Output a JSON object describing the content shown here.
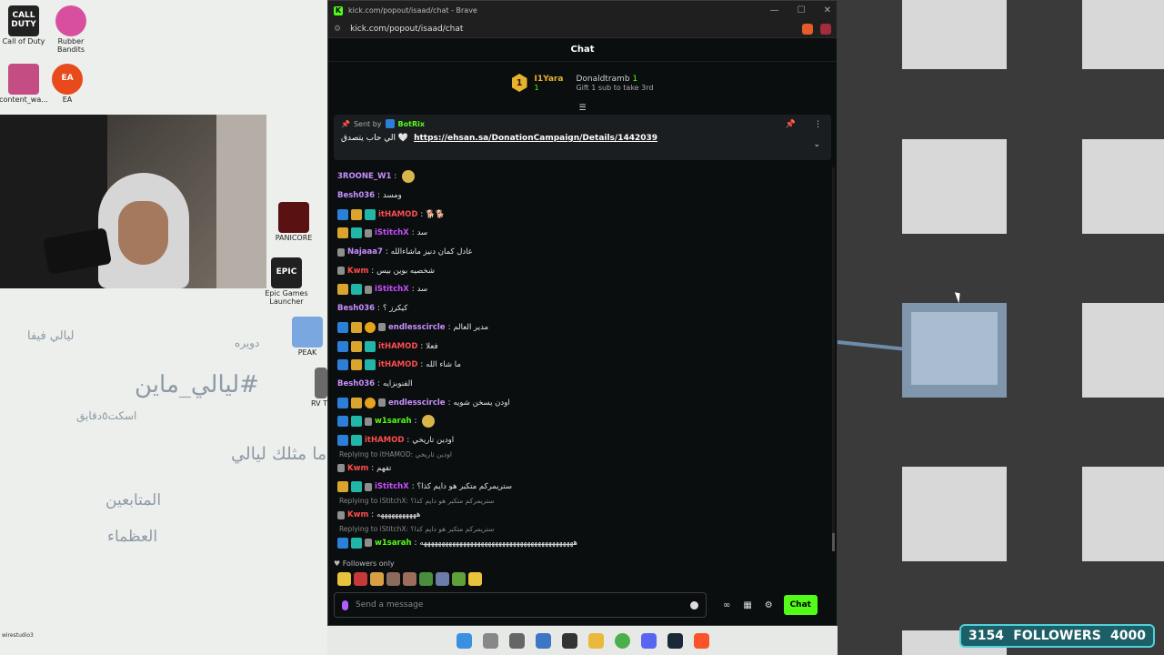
{
  "desktop": {
    "icons": [
      {
        "label": "Call of Duty",
        "badge": "CALL DUTY",
        "color": "#222222"
      },
      {
        "label": "Rubber Bandits",
        "badge": "",
        "color": "#d84fa0"
      },
      {
        "label": "content_wa...",
        "badge": "",
        "color": "#c44d83"
      },
      {
        "label": "EA",
        "badge": "EA",
        "color": "#e84a1c"
      },
      {
        "label": "PANICORE",
        "badge": "",
        "color": "#5a1111"
      },
      {
        "label": "Epic Games Launcher",
        "badge": "EPIC",
        "color": "#202020"
      },
      {
        "label": "PEAK",
        "badge": "",
        "color": "#7aa7e0"
      },
      {
        "label": "RV T",
        "badge": "",
        "color": "#6a6a6a"
      }
    ],
    "arabic_texts": [
      "ليالي فيفا",
      "دويره",
      "#ليالي_ماين",
      "اسكت٥دقايق",
      "ما مثلك ليالي",
      "المتابعين",
      "العظماء"
    ],
    "bottom_text": "wirestudio3"
  },
  "window": {
    "title": "kick.com/popout/isaad/chat - Brave",
    "url": "kick.com/popout/isaad/chat",
    "controls": [
      "—",
      "☐",
      "✕"
    ]
  },
  "chat": {
    "header": "Chat",
    "leaderboard": {
      "first": {
        "rank": "1",
        "name": "I1Yara",
        "count": "1"
      },
      "second": {
        "name": "Donaldtramb",
        "count": "1",
        "gift_text": "Gift 1 sub to take 3rd"
      }
    },
    "pinned": {
      "sent_by": "Sent by",
      "bot_name": "BotRix",
      "message": "الي حاب يتصدق 🤍",
      "link": "https://ehsan.sa/DonationCampaign/Details/1442039"
    },
    "messages": [
      {
        "user": "3ROONE_W1",
        "color": "#c88fff",
        "text": "",
        "badges": []
      },
      {
        "user": "Besh036",
        "color": "#c88fff",
        "text": "ومسد",
        "badges": []
      },
      {
        "user": "itHAMOD",
        "color": "#ff4d4d",
        "text": "🐕🐕",
        "badges": [
          "b-blue",
          "b-crown",
          "b-teal"
        ]
      },
      {
        "user": "iStitchX",
        "color": "#c94dff",
        "text": "سد",
        "badges": [
          "b-crown",
          "b-teal",
          "b-ic"
        ]
      },
      {
        "user": "Najaaa7",
        "color": "#c88fff",
        "text": "عادل كمان دنيز ماشاءالله",
        "badges": [
          "b-ic"
        ]
      },
      {
        "user": "Kwm",
        "color": "#ff4d4d",
        "text": "شخصيه بوين بيس",
        "badges": [
          "b-ic"
        ]
      },
      {
        "user": "iStitchX",
        "color": "#c94dff",
        "text": "سد",
        "badges": [
          "b-crown",
          "b-teal",
          "b-ic"
        ]
      },
      {
        "user": "Besh036",
        "color": "#c88fff",
        "text": "كيكرز ؟",
        "badges": []
      },
      {
        "user": "endlesscircle",
        "color": "#c88fff",
        "text": "مدير العالم",
        "badges": [
          "b-blue",
          "b-crown",
          "b-sub",
          "b-ic"
        ]
      },
      {
        "user": "itHAMOD",
        "color": "#ff4d4d",
        "text": "فعلا",
        "badges": [
          "b-blue",
          "b-crown",
          "b-teal"
        ]
      },
      {
        "user": "itHAMOD",
        "color": "#ff4d4d",
        "text": "ما شاء الله",
        "badges": [
          "b-blue",
          "b-crown",
          "b-teal"
        ]
      },
      {
        "user": "Besh036",
        "color": "#c88fff",
        "text": "الفنوبزايه",
        "badges": []
      },
      {
        "user": "endlesscircle",
        "color": "#c88fff",
        "text": "اودن يسخن شويه",
        "badges": [
          "b-blue",
          "b-crown",
          "b-sub",
          "b-ic"
        ]
      },
      {
        "user": "w1sarah",
        "color": "#53fc18",
        "text": "",
        "badges": [
          "b-blue",
          "b-teal",
          "b-ic"
        ]
      },
      {
        "user": "itHAMOD",
        "color": "#ff4d4d",
        "text": "اودين تاريخي",
        "badges": [
          "b-blue",
          "b-teal"
        ]
      },
      {
        "reply": "Replying to itHAMOD: اودين تاريخي"
      },
      {
        "user": "Kwm",
        "color": "#ff4d4d",
        "text": "تفهم",
        "badges": [
          "b-ic"
        ]
      },
      {
        "user": "iStitchX",
        "color": "#c94dff",
        "text": "ستريمركم متكبر هو دايم كذا؟",
        "badges": [
          "b-crown",
          "b-teal",
          "b-ic"
        ]
      },
      {
        "reply": "Replying to iStitchX: ستريمركم متكبر هو دايم كذا؟"
      },
      {
        "user": "Kwm",
        "color": "#ff4d4d",
        "text": "هههههههههههه",
        "badges": [
          "b-ic"
        ]
      },
      {
        "reply": "Replying to iStitchX: ستريمركم متكبر هو دايم كذا؟"
      },
      {
        "user": "w1sarah",
        "color": "#53fc18",
        "text": "هههههههههههههههههههههههههههههههههههههههههههه",
        "badges": [
          "b-blue",
          "b-teal",
          "b-ic"
        ]
      }
    ],
    "followers_only": "Followers only",
    "input_placeholder": "Send a message",
    "send_label": "Chat"
  },
  "overlay": {
    "followers_count": "3154",
    "followers_label": "FOLLOWERS",
    "followers_goal": "4000"
  },
  "colors": {
    "accent": "#53fc18",
    "bg": "#0b0e0f"
  }
}
